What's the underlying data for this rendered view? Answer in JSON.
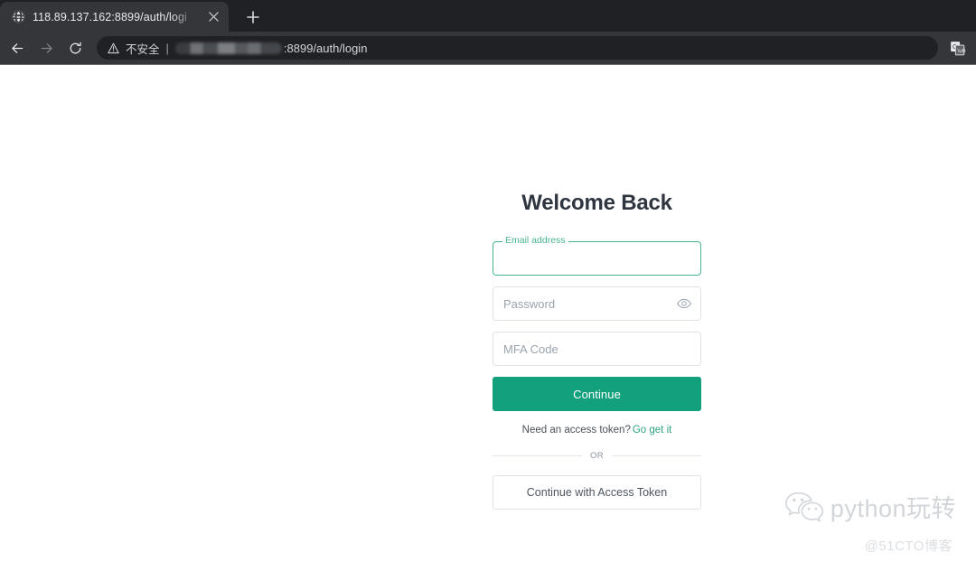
{
  "browser": {
    "tab": {
      "title": "118.89.137.162:8899/auth/logi",
      "favicon_name": "globe-icon",
      "close_label": "✕"
    },
    "new_tab_label": "+",
    "nav": {
      "back_label": "←",
      "forward_label": "→",
      "reload_label": "⟳"
    },
    "omnibox": {
      "security_text": "不安全",
      "separator": "|",
      "host_redacted": true,
      "url_visible": ":8899/auth/login"
    },
    "translate_label": "G"
  },
  "page": {
    "title": "Welcome Back",
    "email_field": {
      "label": "Email address",
      "value": "",
      "placeholder": ""
    },
    "password_field": {
      "placeholder": "Password",
      "value": "",
      "toggle_icon": "eye-icon"
    },
    "mfa_field": {
      "placeholder": "MFA Code",
      "value": ""
    },
    "continue_button": "Continue",
    "token_prompt": "Need an access token?",
    "token_link": "Go get it",
    "or_label": "OR",
    "access_token_button": "Continue with Access Token",
    "colors": {
      "accent_green": "#13a07c",
      "focus_border": "#49b391",
      "link_green": "#2fa37f",
      "title_color": "#2f3640"
    }
  },
  "watermark": {
    "brand": "python玩转",
    "credit": "@51CTO博客",
    "logo_name": "wechat-icon"
  }
}
